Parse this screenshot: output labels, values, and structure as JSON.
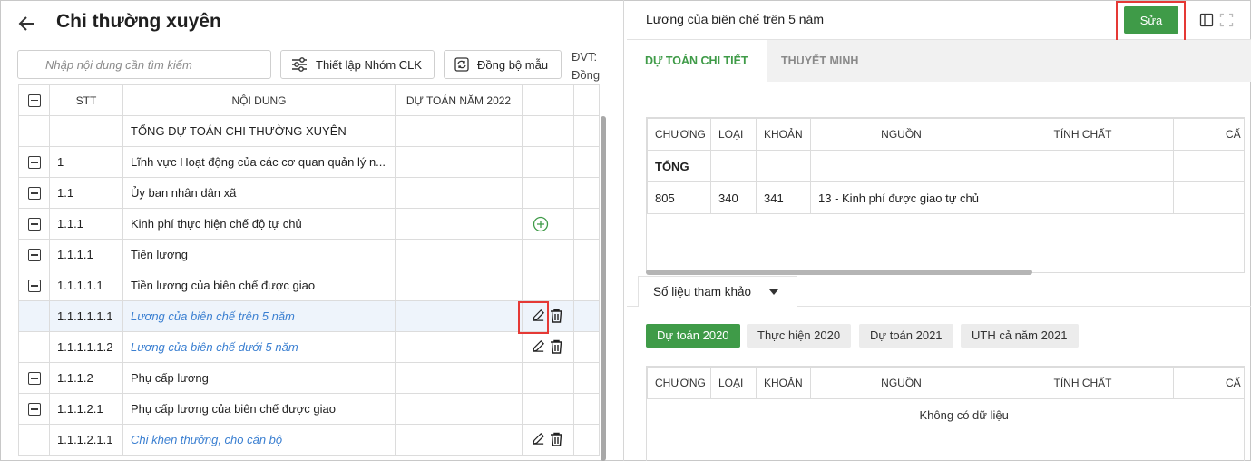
{
  "left": {
    "title": "Chi thường xuyên",
    "search_placeholder": "Nhập nội dung cần tìm kiếm",
    "btn_group": "Thiết lập Nhóm CLK",
    "btn_sync": "Đồng bộ mẫu",
    "unit_label": "ĐVT:",
    "unit_value": "Đồng",
    "columns": [
      "STT",
      "NỘI DUNG",
      "DỰ TOÁN NĂM 2022"
    ],
    "rows": [
      {
        "stt": "",
        "content": "TỔNG DỰ TOÁN CHI THƯỜNG XUYÊN",
        "collapse": false,
        "link": false,
        "actions": "none"
      },
      {
        "stt": "1",
        "content": "Lĩnh vực Hoạt động của các cơ quan quản lý n...",
        "collapse": true,
        "link": false,
        "actions": "none"
      },
      {
        "stt": "1.1",
        "content": "Ủy ban nhân dân xã",
        "collapse": true,
        "link": false,
        "actions": "none"
      },
      {
        "stt": "1.1.1",
        "content": "Kinh phí thực hiện chế độ tự chủ",
        "collapse": true,
        "link": false,
        "actions": "add"
      },
      {
        "stt": "1.1.1.1",
        "content": "Tiền lương",
        "collapse": true,
        "link": false,
        "actions": "none"
      },
      {
        "stt": "1.1.1.1.1",
        "content": "Tiền lương của biên chế được giao",
        "collapse": true,
        "link": false,
        "actions": "none"
      },
      {
        "stt": "1.1.1.1.1.1",
        "content": "Lương của biên chế trên 5 năm",
        "collapse": false,
        "link": true,
        "actions": "edit-delete",
        "selected": true
      },
      {
        "stt": "1.1.1.1.1.2",
        "content": "Lương của biên chế dưới 5 năm",
        "collapse": false,
        "link": true,
        "actions": "edit-delete"
      },
      {
        "stt": "1.1.1.2",
        "content": "Phụ cấp lương",
        "collapse": true,
        "link": false,
        "actions": "none"
      },
      {
        "stt": "1.1.1.2.1",
        "content": "Phụ cấp lương của biên chế được giao",
        "collapse": true,
        "link": false,
        "actions": "none"
      },
      {
        "stt": "1.1.1.2.1.1",
        "content": "Chi khen thưởng, cho cán bộ",
        "collapse": false,
        "link": true,
        "actions": "edit-delete"
      }
    ]
  },
  "right": {
    "title": "Lương của biên chế trên 5 năm",
    "edit_button": "Sửa",
    "tab_detail": "DỰ TOÁN CHI TIẾT",
    "tab_note": "THUYẾT MINH",
    "columns": [
      "CHƯƠNG",
      "LOẠI",
      "KHOẢN",
      "NGUỒN",
      "TÍNH CHẤT",
      "CẤ"
    ],
    "total_label": "TỔNG",
    "detail_row": {
      "chuong": "805",
      "loai": "340",
      "khoan": "341",
      "nguon": "13 - Kinh phí được giao tự chủ"
    },
    "ref_tab": "Số liệu tham khảo",
    "chips": [
      "Dự toán 2020",
      "Thực hiện 2020",
      "Dự toán 2021",
      "UTH cả năm 2021"
    ],
    "no_data": "Không có dữ liệu"
  },
  "colors": {
    "accent": "#3f9b48",
    "link": "#3a7fd1",
    "highlight": "#e53935"
  }
}
